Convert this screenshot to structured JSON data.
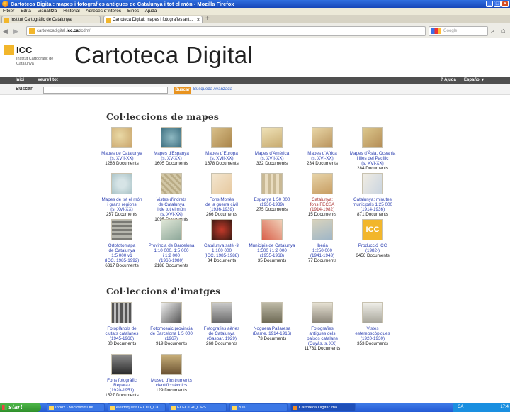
{
  "browser": {
    "window_title": "Cartoteca Digital: mapes i fotografies antigues de Catalunya i tot el món - Mozilla Firefox",
    "menu": [
      "Fitxer",
      "Edita",
      "Visualitza",
      "Historial",
      "Adreces d'interès",
      "Eines",
      "Ajuda"
    ],
    "tabs": [
      {
        "label": "Institut Cartogràfic de Catalunya"
      },
      {
        "label": "Cartoteca Digital: mapes i fotografies ant..."
      }
    ],
    "url_prefix": "cartotecadigital.",
    "url_host": "icc.cat",
    "url_suffix": "/cdm/",
    "search_engine": "Google",
    "window_buttons": [
      "_",
      "□",
      "×"
    ]
  },
  "site": {
    "logo_name": "ICC",
    "logo_sub": "Institut Cartogràfic de Catalunya",
    "title": "Cartoteca Digital",
    "nav": {
      "inici": "Inici",
      "veure": "Veure'l tot",
      "ajuda": "? Ajuda",
      "lang": "Español ▾"
    },
    "search_label": "Buscar",
    "search_value": "",
    "search_button": "Buscar",
    "advanced_search": "Búsqueda Avanzada"
  },
  "maps_section": {
    "title": "Col·leccions de mapes",
    "items": [
      {
        "name": "Mapes de Catalunya (s. XVII-XX)",
        "lines": [
          "Mapes de Catalunya",
          "(s. XVII-XX)"
        ],
        "count": "1286 Documents"
      },
      {
        "name": "Mapes d'Espanya (s. XV-XX)",
        "lines": [
          "Mapes d'Espanya",
          "(s. XV-XX)"
        ],
        "count": "1605 Documents"
      },
      {
        "name": "Mapes d'Europa (s. XVII-XX)",
        "lines": [
          "Mapes d'Europa",
          "(s. XVII-XX)"
        ],
        "count": "1678 Documents"
      },
      {
        "name": "Mapes d'Amèrica (s. XVII-XX)",
        "lines": [
          "Mapes d'Amèrica",
          "(s. XVII-XX)"
        ],
        "count": "332 Documents"
      },
      {
        "name": "Mapes d'Àfrica (s. XVI-XX)",
        "lines": [
          "Mapes d'Àfrica",
          "(s. XVI-XX)"
        ],
        "count": "234 Documents"
      },
      {
        "name": "Mapes d'Àsia, Oceania i illes del Pacífic (s. XVI-XX)",
        "lines": [
          "Mapes d'Àsia, Oceania",
          "i illes del Pacífic",
          "(s. XVI-XX)"
        ],
        "count": "284 Documents"
      },
      {
        "name": "Mapes de tot el món i grans regions (s. XVI-XX)",
        "lines": [
          "Mapes de tot el món",
          "i grans regions",
          "(s. XVI-XX)"
        ],
        "count": "257 Documents"
      },
      {
        "name": "Vistes d'indrets de Catalunya i de tot el món (s. XVI-XX)",
        "lines": [
          "Vistes d'indrets",
          "de Catalunya",
          "i de tot el món",
          "(s. XVI-XX)"
        ],
        "count": "1095 Documents"
      },
      {
        "name": "Fons Monès de la guerra civil (1936-1939)",
        "lines": [
          "Fons Monès",
          "de la guerra civil",
          "(1936-1939)"
        ],
        "count": "266 Documents"
      },
      {
        "name": "Espanya 1:50 000 (1936-1939)",
        "lines": [
          "Espanya 1:50 000",
          "(1936-1939)"
        ],
        "count": "275 Documents"
      },
      {
        "name": "Catalunya: fons FECSA (1914-1982)",
        "lines": [
          "Catalunya:",
          "fons FECSA",
          "(1914-1982)"
        ],
        "count": "15 Documents",
        "red": true
      },
      {
        "name": "Catalunya: minutes municipals 1:25 000 (1914-1936)",
        "lines": [
          "Catalunya: minutes",
          "municipals 1:25 000",
          "(1914-1936)"
        ],
        "count": "871 Documents"
      },
      {
        "name": "Ortofotomapa de Catalunya 1:5 000 v1 (ICC, 1985-1992)",
        "lines": [
          "Ortofotomapa",
          "de Catalunya",
          "1:5 000 v1",
          "(ICC, 1985-1992)"
        ],
        "count": "6317 Documents"
      },
      {
        "name": "Provincia de Barcelona 1:10 000, 1:5 000 i 1:2 000 (1966-1980)",
        "lines": [
          "Provincia de Barcelona",
          "1:10 000, 1:5 000",
          "i 1:2 000",
          "(1966-1980)"
        ],
        "count": "2188 Documents"
      },
      {
        "name": "Catalunya satèl·lit 1:100 000 (ICC, 1985-1988)",
        "lines": [
          "Catalunya satèl·lit",
          "1:100 000",
          "(ICC, 1985-1988)"
        ],
        "count": "34 Documents"
      },
      {
        "name": "Municipis de Catalunya 1:500 i 1:2 000 (1955-1968)",
        "lines": [
          "Municipis de Catalunya",
          "1:500 i 1:2 000",
          "(1955-1968)"
        ],
        "count": "35 Documents"
      },
      {
        "name": "Iberia 1:250 000 (1941-1943)",
        "lines": [
          "Iberia",
          "1:250 000",
          "(1941-1943)"
        ],
        "count": "77 Documents"
      },
      {
        "name": "Producció ICC (1982-)",
        "lines": [
          "Producció ICC",
          "(1982-)"
        ],
        "count": "6456 Documents"
      }
    ]
  },
  "images_section": {
    "title": "Col·leccions d'imatges",
    "items": [
      {
        "name": "Fotoplànols de ciutats catalanes (1945-1966)",
        "lines": [
          "Fotoplànols de",
          "ciutats catalanes",
          "(1945-1966)"
        ],
        "count": "80 Documents"
      },
      {
        "name": "Fotomosaic provincia de Barcelona 1:5 000 (1967)",
        "lines": [
          "Fotomosaic provincia",
          "de Barcelona 1:5 000",
          "(1967)"
        ],
        "count": "919 Documents"
      },
      {
        "name": "Fotografies aèries de Catalunya (Gaspar, 1929)",
        "lines": [
          "Fotografies aèries",
          "de Catalunya",
          "(Gaspar, 1929)"
        ],
        "count": "268 Documents"
      },
      {
        "name": "Noguera Pallaresa (Barrie, 1914-1916)",
        "lines": [
          "Noguera Pallaresa",
          "(Barrie, 1914-1916)"
        ],
        "count": "73 Documents"
      },
      {
        "name": "Fotografies antigues dels països catalans (Cuyàs, s. XX)",
        "lines": [
          "Fotografies",
          "antigues dels",
          "països catalans",
          "(Cuyàs, s. XX)"
        ],
        "count": "11731 Documents"
      },
      {
        "name": "Vistes estereoscòpiques (1920-1930)",
        "lines": [
          "Vistes",
          "estereoscòpiques",
          "(1920-1930)"
        ],
        "count": "353 Documents"
      },
      {
        "name": "Fons fotogràfic Reparaz (1920-1951)",
        "lines": [
          "Fons fotogràfic",
          "Reparaz",
          "(1920-1951)"
        ],
        "count": "1527 Documents"
      },
      {
        "name": "Museu d'instruments científicotècnics",
        "lines": [
          "Museu d'instruments",
          "científicotècnics"
        ],
        "count": "129 Documents"
      }
    ]
  },
  "taskbar": {
    "start": "start",
    "items": [
      "Inbox - Microsoft Out...",
      "electriques\\TEXTO_Ca...",
      "ELECTRIQUES",
      "2007",
      "Cartoteca Digital: ma..."
    ],
    "tray": "CA",
    "clock": "17:4"
  }
}
